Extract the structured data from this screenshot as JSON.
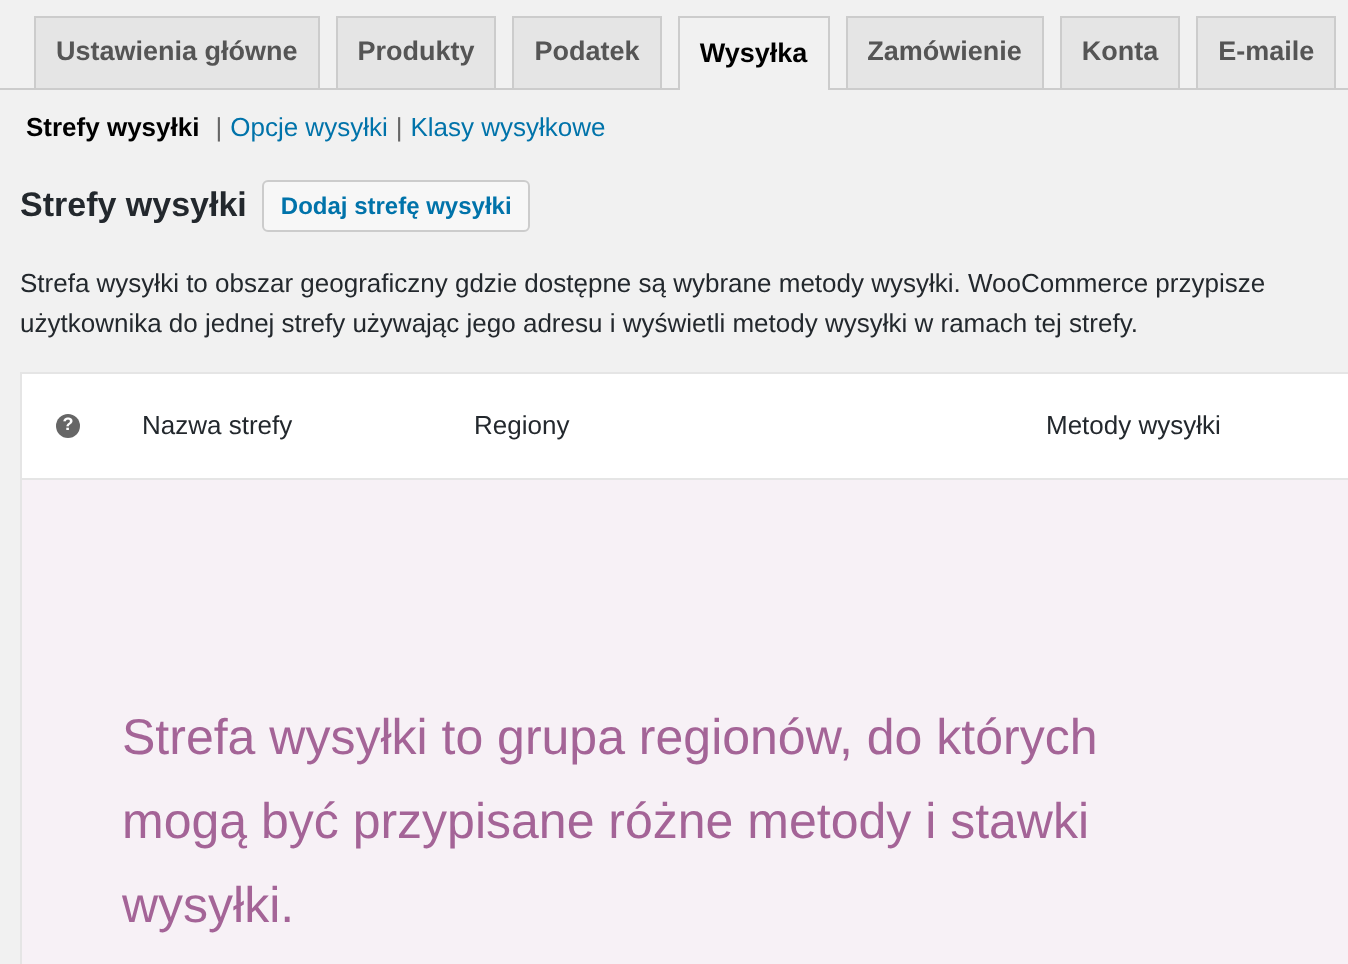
{
  "tabs": [
    {
      "label": "Ustawienia główne",
      "selected": false
    },
    {
      "label": "Produkty",
      "selected": false
    },
    {
      "label": "Podatek",
      "selected": false
    },
    {
      "label": "Wysyłka",
      "selected": true
    },
    {
      "label": "Zamówienie",
      "selected": false
    },
    {
      "label": "Konta",
      "selected": false
    },
    {
      "label": "E-maile",
      "selected": false
    }
  ],
  "subnav": [
    {
      "label": "Strefy wysyłki",
      "selected": true
    },
    {
      "label": "Opcje wysyłki",
      "selected": false
    },
    {
      "label": "Klasy wysyłkowe",
      "selected": false
    }
  ],
  "separator": "|",
  "heading": "Strefy wysyłki",
  "add_button": "Dodaj strefę wysyłki",
  "description": "Strefa wysyłki to obszar geograficzny gdzie dostępne są wybrane metody wysyłki. WooCommerce przypisze użytkownika do jednej strefy używając jego adresu i wyświetli metody wysyłki w ramach tej strefy.",
  "table": {
    "help": "?",
    "columns": [
      "Nazwa strefy",
      "Regiony",
      "Metody wysyłki"
    ],
    "empty_message": "Strefa wysyłki to grupa regionów, do których mogą być przypisane różne metody i stawki wysyłki."
  }
}
